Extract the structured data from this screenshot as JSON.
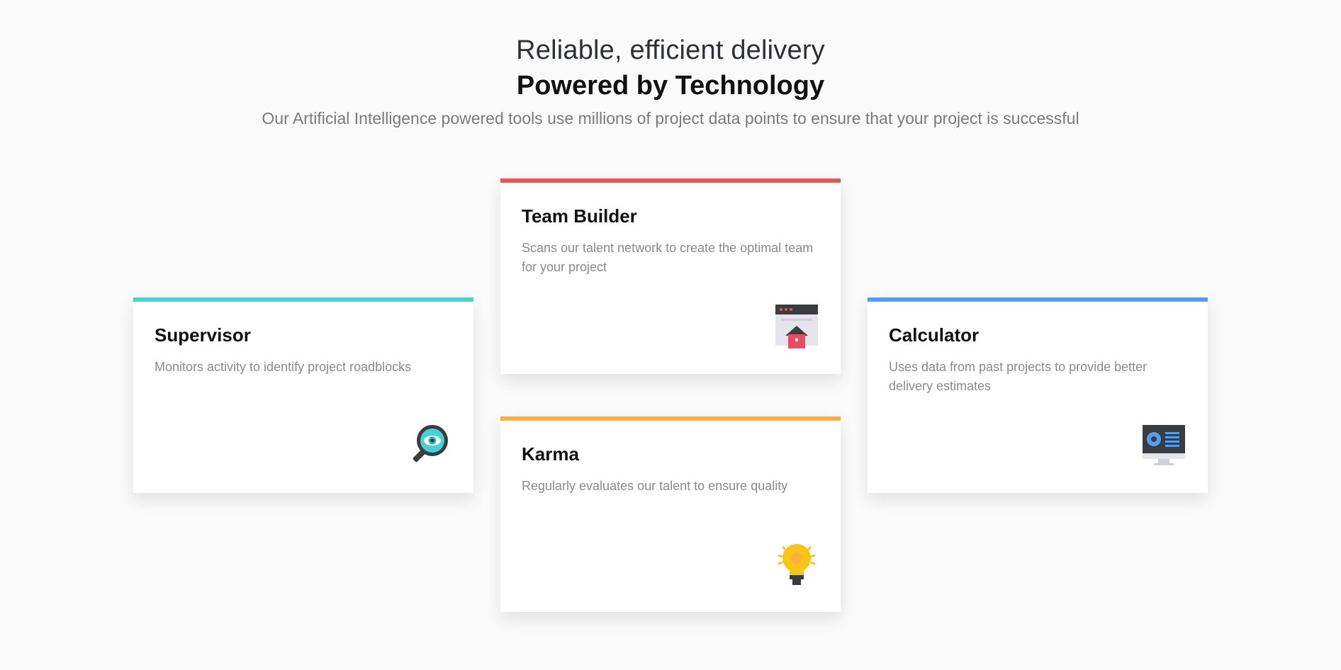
{
  "header": {
    "eyebrow": "Reliable, efficient delivery",
    "title": "Powered by Technology",
    "subtitle": "Our Artificial Intelligence powered tools use millions of project data points to ensure that your project is successful"
  },
  "cards": [
    {
      "title": "Supervisor",
      "description": "Monitors activity to identify project roadblocks",
      "accent": "#45d3d3",
      "icon": "magnifier-eye-icon"
    },
    {
      "title": "Team Builder",
      "description": "Scans our talent network to create the optimal team for your project",
      "accent": "#ea5454",
      "icon": "web-window-house-icon"
    },
    {
      "title": "Karma",
      "description": "Regularly evaluates our talent to ensure quality",
      "accent": "#fcaf41",
      "icon": "light-bulb-icon"
    },
    {
      "title": "Calculator",
      "description": "Uses data from past projects to provide better delivery estimates",
      "accent": "#549ef2",
      "icon": "monitor-dashboard-icon"
    }
  ],
  "colors": {
    "background": "#fafafa",
    "card": "#ffffff",
    "heading": "#111111",
    "body_text": "#8a8a8a"
  }
}
